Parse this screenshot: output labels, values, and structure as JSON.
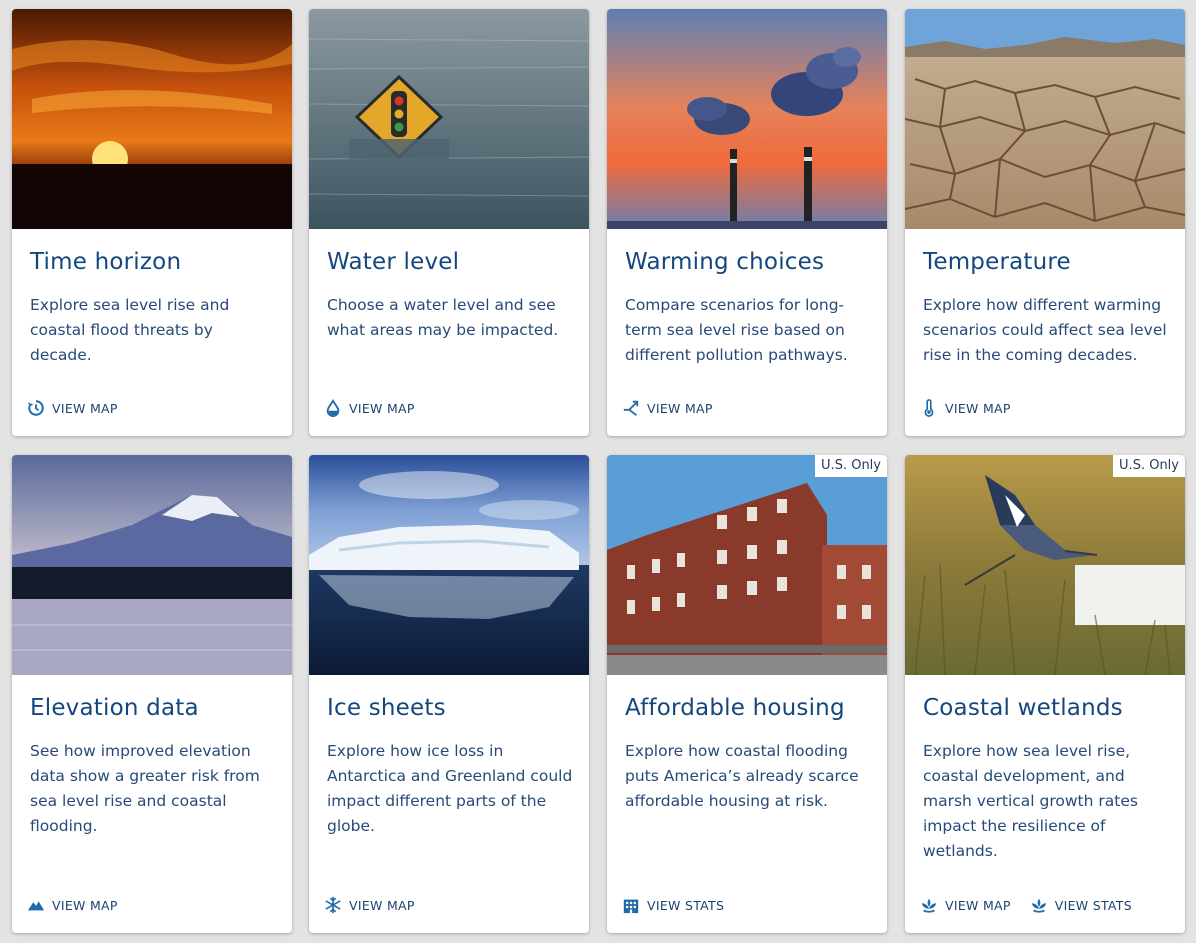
{
  "cards": [
    {
      "title": "Time horizon",
      "description": "Explore sea level rise and coastal flood threats by decade.",
      "actions": [
        {
          "label": "VIEW MAP",
          "icon": "clock-history-icon"
        }
      ]
    },
    {
      "title": "Water level",
      "description": "Choose a water level and see what areas may be impacted.",
      "actions": [
        {
          "label": "VIEW MAP",
          "icon": "water-drop-icon"
        }
      ]
    },
    {
      "title": "Warming choices",
      "description": "Compare scenarios for long-term sea level rise based on different pollution pathways.",
      "actions": [
        {
          "label": "VIEW MAP",
          "icon": "branch-arrows-icon"
        }
      ]
    },
    {
      "title": "Temperature",
      "description": "Explore how different warming scenarios could affect sea level rise in the coming decades.",
      "actions": [
        {
          "label": "VIEW MAP",
          "icon": "thermometer-icon"
        }
      ]
    },
    {
      "title": "Elevation data",
      "description": "See how improved elevation data show a greater risk from sea level rise and coastal flooding.",
      "actions": [
        {
          "label": "VIEW MAP",
          "icon": "mountains-icon"
        }
      ]
    },
    {
      "title": "Ice sheets",
      "description": "Explore how ice loss in Antarctica and Greenland could impact different parts of the globe.",
      "actions": [
        {
          "label": "VIEW MAP",
          "icon": "snowflake-icon"
        }
      ]
    },
    {
      "title": "Affordable housing",
      "badge": "U.S. Only",
      "description": "Explore how coastal flooding puts America’s already scarce affordable housing at risk.",
      "actions": [
        {
          "label": "VIEW STATS",
          "icon": "building-icon"
        }
      ]
    },
    {
      "title": "Coastal wetlands",
      "badge": "U.S. Only",
      "description": "Explore how sea level rise, coastal development, and marsh vertical growth rates impact the resilience of wetlands.",
      "actions": [
        {
          "label": "VIEW MAP",
          "icon": "wetland-plant-icon"
        },
        {
          "label": "VIEW STATS",
          "icon": "wetland-plant-icon"
        }
      ]
    }
  ],
  "colors": {
    "title": "#14477d",
    "text": "#274a78",
    "icon": "#1f6aa8",
    "background": "#e3e3e3"
  }
}
